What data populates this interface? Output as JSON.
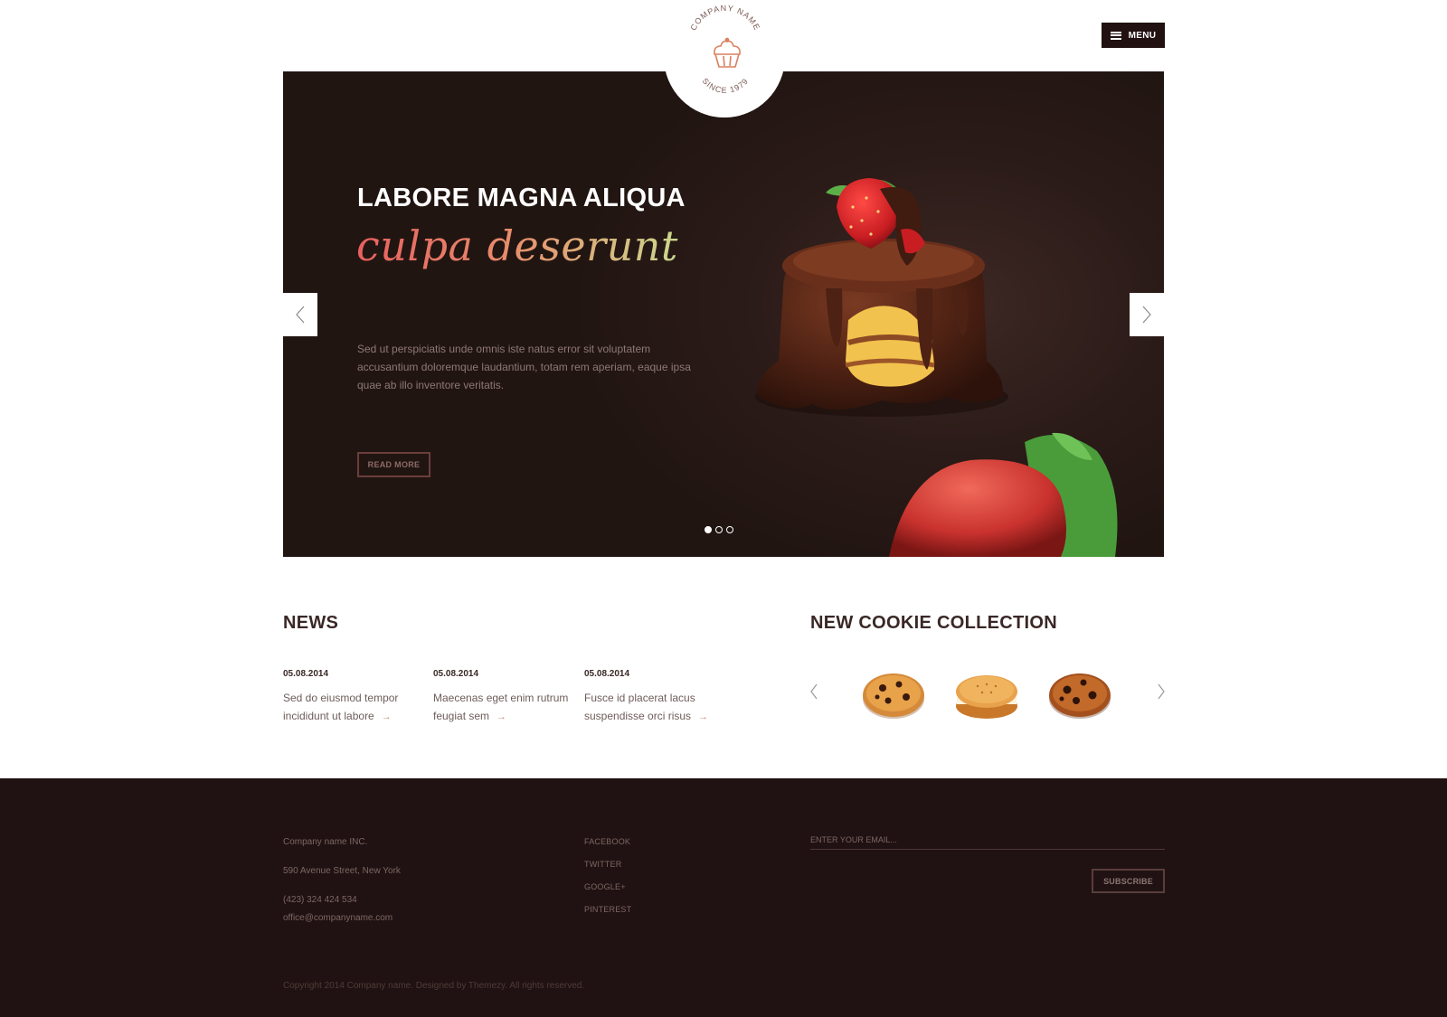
{
  "header": {
    "logo": {
      "top_text": "COMPANY NAME",
      "bottom_text": "SINCE 1979",
      "icon": "cupcake-icon"
    },
    "menu_label": "MENU",
    "menu_icon": "hamburger-icon"
  },
  "hero": {
    "heading": "LABORE MAGNA ALIQUA",
    "script": "culpa deserunt",
    "description": "Sed ut perspiciatis unde omnis iste natus error sit voluptatem accusantium doloremque laudantium, totam rem aperiam, eaque ipsa quae ab illo inventore veritatis.",
    "button_label": "READ MORE",
    "slides_total": 3,
    "active_slide": 1,
    "prev_icon": "chevron-left-icon",
    "next_icon": "chevron-right-icon"
  },
  "news": {
    "title": "NEWS",
    "items": [
      {
        "date": "05.08.2014",
        "text": "Sed do eiusmod tempor incididunt ut labore"
      },
      {
        "date": "05.08.2014",
        "text": "Maecenas eget enim rutrum feugiat sem"
      },
      {
        "date": "05.08.2014",
        "text": "Fusce id placerat lacus suspendisse orci risus"
      }
    ]
  },
  "cookies": {
    "title": "NEW COOKIE COLLECTION",
    "items": [
      "chocolate-chip-cookie",
      "cream-sandwich-cookie",
      "chocolate-cookie"
    ]
  },
  "footer": {
    "company": "Company name INC.",
    "address": "590 Avenue Street, New York",
    "phone": "(423) 324 424 534",
    "email": "office@companyname.com",
    "social": [
      "FACEBOOK",
      "TWITTER",
      "GOOGLE+",
      "PINTEREST"
    ],
    "email_placeholder": "ENTER YOUR EMAIL...",
    "subscribe_label": "SUBSCRIBE",
    "copyright": "Copyright 2014 Company name. Designed by Themezy. All rights reserved."
  },
  "colors": {
    "page_bg": "#ffffff",
    "hero_bg": "#2b1b18",
    "footer_bg": "#201212",
    "heading_text": "#3a2826",
    "accent_coral": "#e8605f",
    "accent_green": "#cbd78c",
    "chocolate": "#5a2a1a",
    "strawberry": "#d8262c"
  }
}
